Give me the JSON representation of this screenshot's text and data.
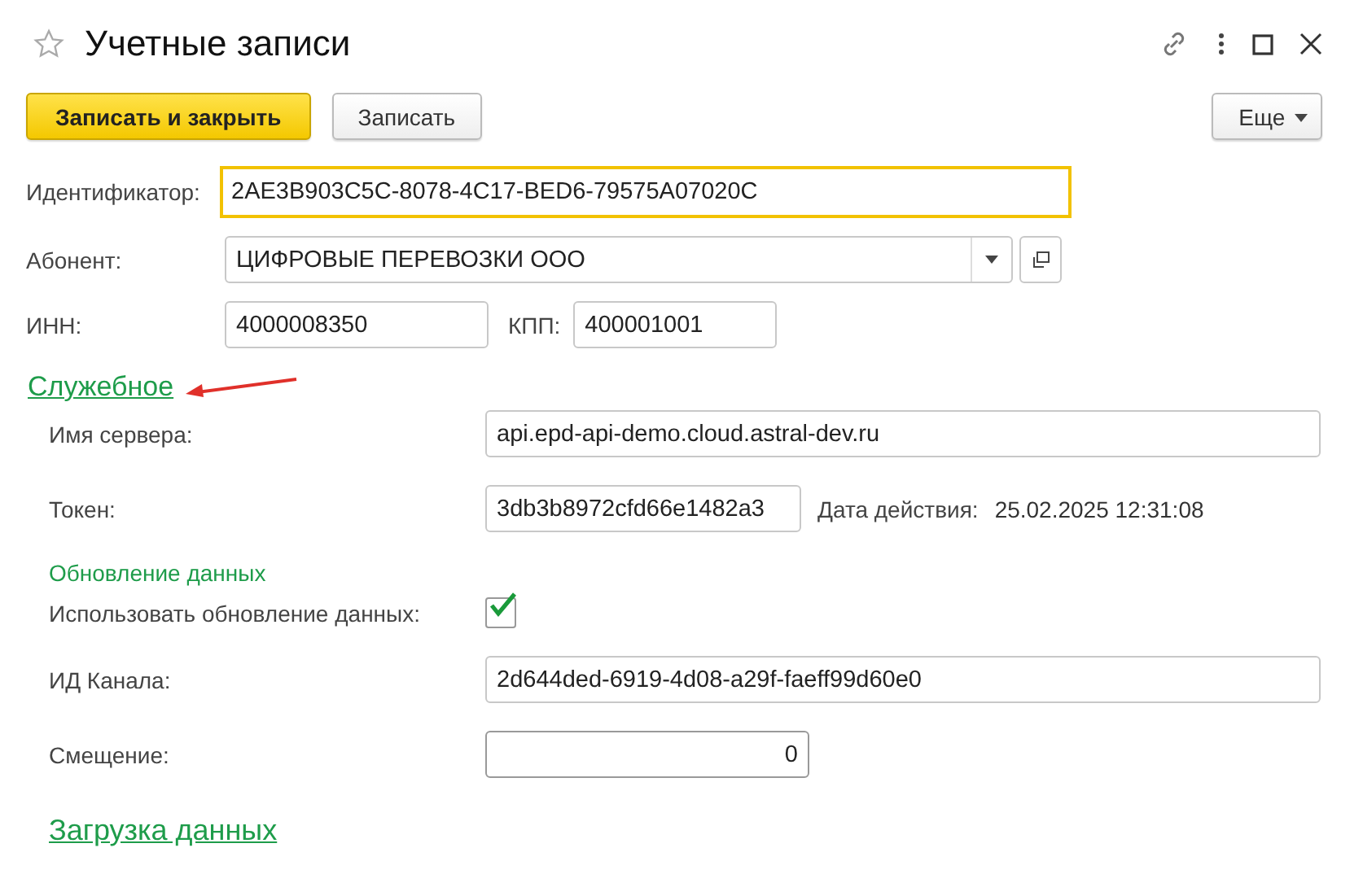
{
  "window": {
    "title": "Учетные записи",
    "favorite": false
  },
  "toolbar": {
    "buttons": [
      {
        "label": "Записать и закрыть",
        "kind": "primary"
      },
      {
        "label": "Записать",
        "kind": "normal"
      }
    ],
    "more": "Еще"
  },
  "fields": [
    {
      "label": "Идентификатор:",
      "value": "2AE3B903C5C-8078-4C17-BED6-79575A07020C",
      "focused": true
    },
    {
      "label": "Абонент:",
      "value": "ЦИФРОВЫЕ ПЕРЕВОЗКИ ООО",
      "kind": "select"
    }
  ],
  "inn": {
    "label": "ИНН:",
    "value": "4000008350"
  },
  "kpp": {
    "label": "КПП:",
    "value": "400001001"
  },
  "service_link": "Служебное",
  "service": {
    "server": {
      "label": "Имя сервера:",
      "value": "api.epd-api-demo.cloud.astral-dev.ru"
    },
    "token": {
      "label": "Токен:",
      "value": "3db3b8972cfd66e1482a3",
      "valid_label": "Дата действия:",
      "valid_value": "25.02.2025 12:31:08"
    },
    "update_heading": "Обновление данных",
    "use_update": {
      "label": "Использовать обновление данных:",
      "checked": true
    },
    "channel": {
      "label": "ИД Канала:",
      "value": "2d644ded-6919-4d08-a29f-faeff99d60e0"
    },
    "offset": {
      "label": "Смещение:",
      "value": "0"
    }
  },
  "load_link": "Загрузка данных"
}
